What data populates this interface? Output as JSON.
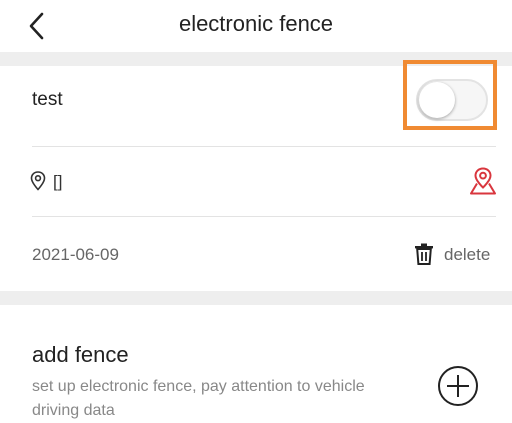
{
  "header": {
    "title": "electronic fence",
    "back_icon": "chevron-left-icon"
  },
  "fence": {
    "name": "test",
    "enabled": false,
    "location_text": "[]",
    "location_icon": "location-pin-icon",
    "map_icon": "map-location-icon",
    "date": "2021-06-09",
    "delete_label": "delete",
    "delete_icon": "trash-icon"
  },
  "add_fence": {
    "title": "add fence",
    "description": "set up electronic fence, pay attention to vehicle driving data",
    "add_icon": "plus-circle-icon"
  },
  "colors": {
    "highlight": "#f08a32",
    "map_icon": "#d9363e",
    "section_separator": "#eeeeee"
  }
}
